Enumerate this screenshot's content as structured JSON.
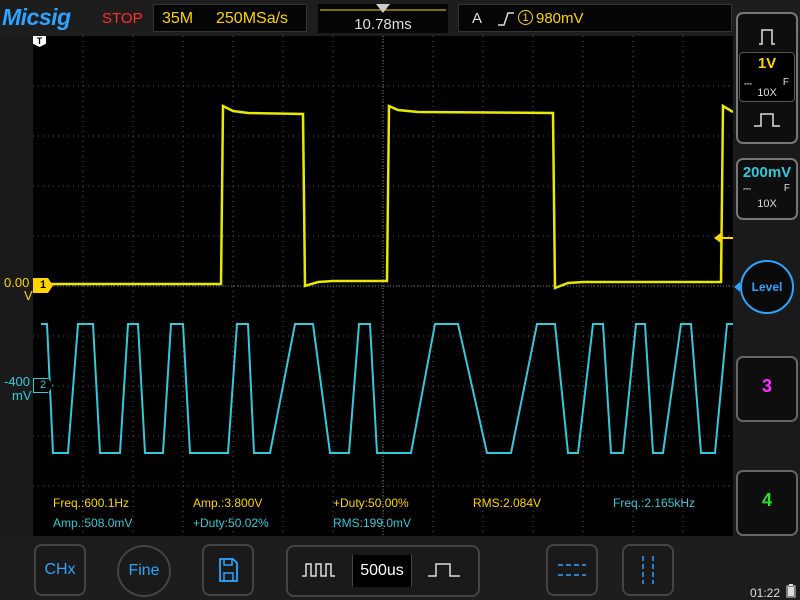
{
  "header": {
    "logo": "Micsig",
    "run_state": "STOP",
    "memory_depth": "35M",
    "sample_rate": "250MSa/s",
    "delay": "10.78ms",
    "trigger_mode": "A",
    "trigger_source": "1",
    "trigger_level": "980mV"
  },
  "screen": {
    "ch1_offset_value": "0.00",
    "ch1_offset_unit": "V",
    "ch1_marker": "1",
    "ch2_offset_value": "-400",
    "ch2_offset_unit": "mV",
    "ch2_marker": "2",
    "trigger_pos_marker": "T"
  },
  "measurements": [
    {
      "label": "Freq.:600.1Hz",
      "color": "#ffd400"
    },
    {
      "label": "Amp.:3.800V",
      "color": "#ffd400"
    },
    {
      "label": "+Duty:50.00%",
      "color": "#ffd400"
    },
    {
      "label": "RMS:2.084V",
      "color": "#ffd400"
    },
    {
      "label": "Freq.:2.165kHz",
      "color": "#35c8d8"
    },
    {
      "label": "Amp.:508.0mV",
      "color": "#35c8d8"
    },
    {
      "label": "+Duty:50.02%",
      "color": "#35c8d8"
    },
    {
      "label": "RMS:199.0mV",
      "color": "#35c8d8"
    }
  ],
  "right_panel": {
    "ch1_scale": "1V",
    "ch1_probe": "10X",
    "ch1_bw": "F",
    "ch2_scale": "200mV",
    "ch2_probe": "10X",
    "ch2_bw": "F",
    "level_label": "Level",
    "ch3_label": "3",
    "ch4_label": "4"
  },
  "bottom": {
    "chx_label": "CHx",
    "fine_label": "Fine",
    "timebase": "500us",
    "clock": "01:22"
  },
  "colors": {
    "ch1": "#e8e800",
    "ch2": "#35c8d8",
    "ch3": "#ff30ff",
    "ch4": "#30e030",
    "accent": "#2ea3ff"
  }
}
